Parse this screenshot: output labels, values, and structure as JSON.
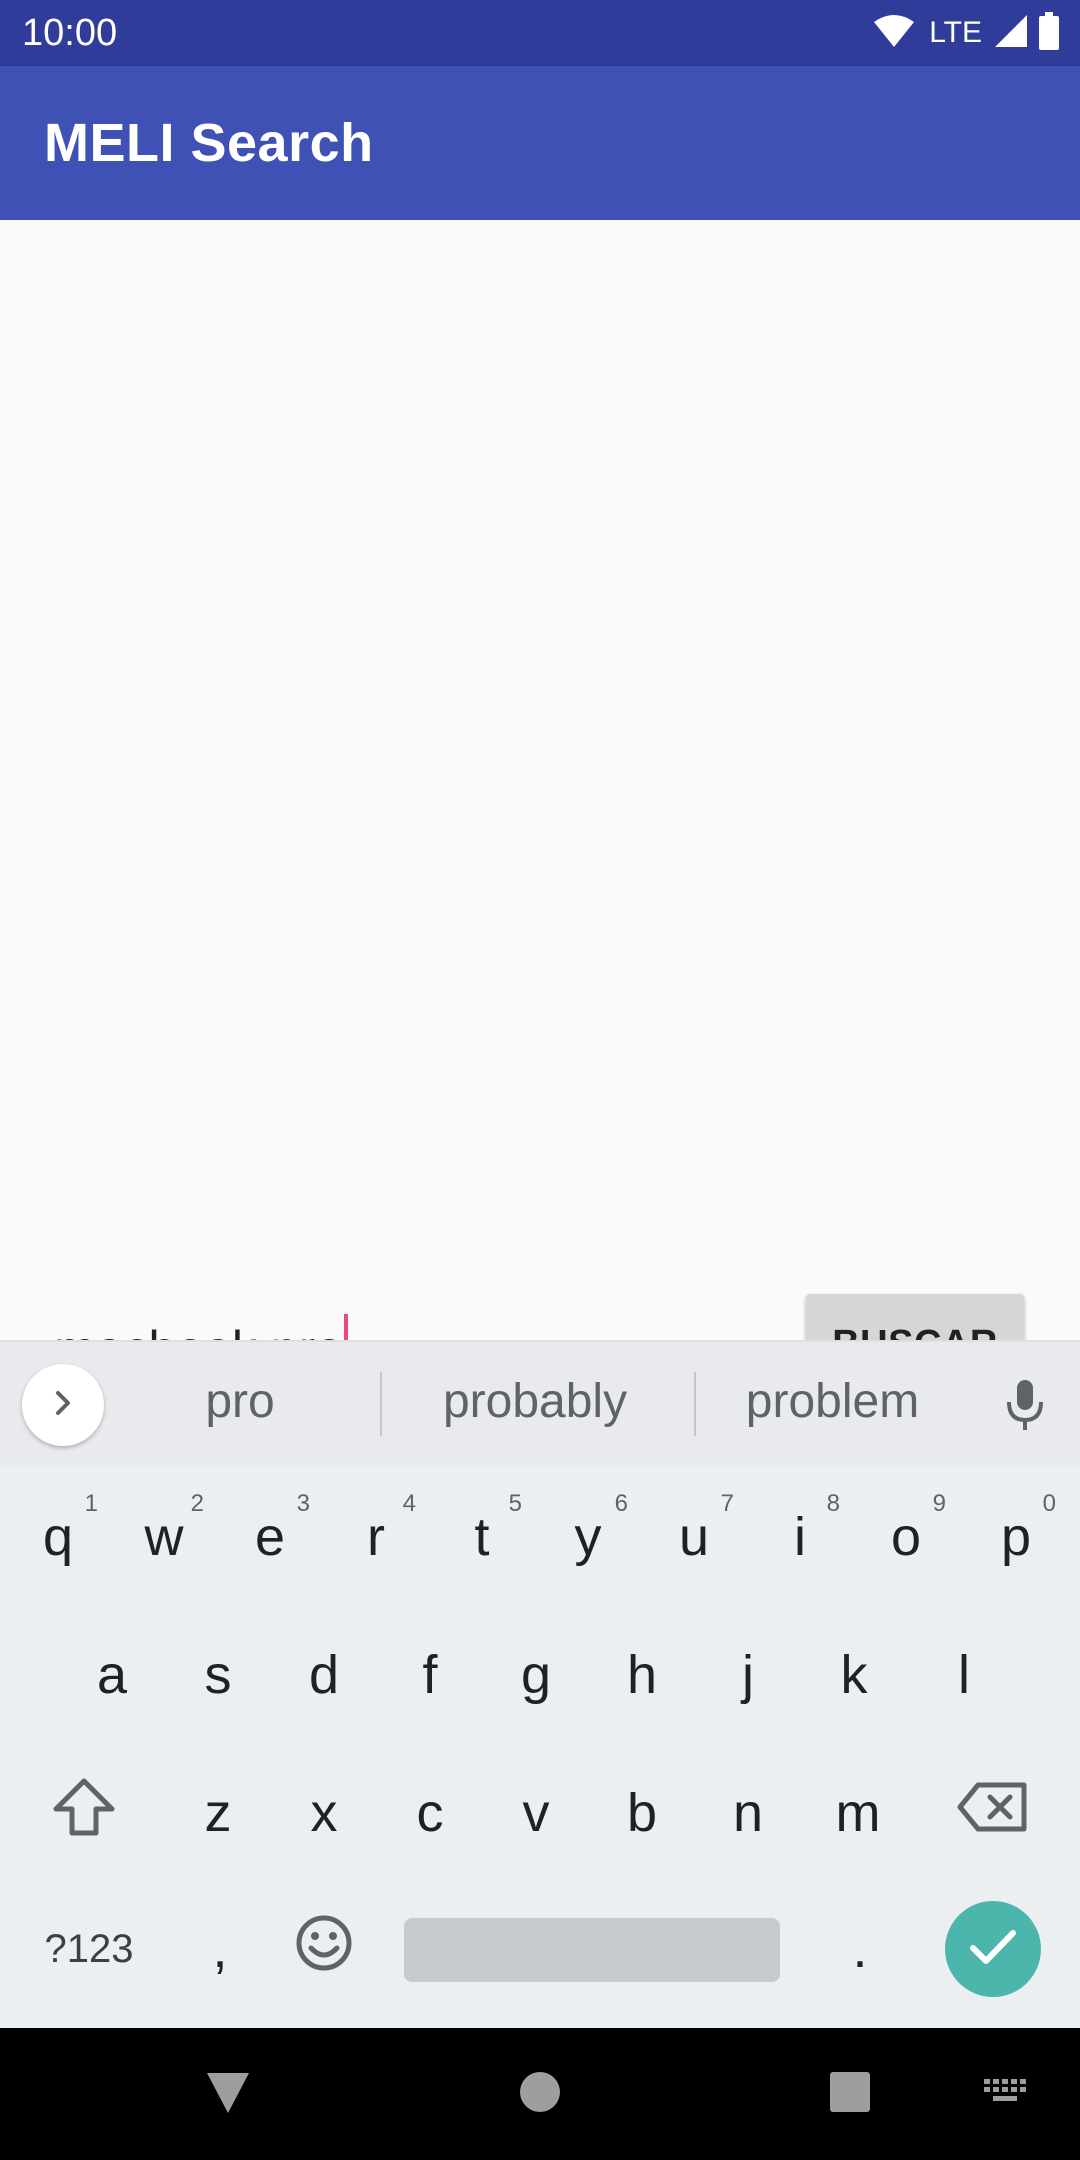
{
  "status_bar": {
    "time": "10:00",
    "network": "LTE"
  },
  "app_bar": {
    "title": "MELI Search"
  },
  "search": {
    "value_prefix": "macbook ",
    "value_current_word": "pro",
    "button_label": "BUSCAR"
  },
  "keyboard": {
    "suggestions": [
      "pro",
      "probably",
      "problem"
    ],
    "row1": [
      "q",
      "w",
      "e",
      "r",
      "t",
      "y",
      "u",
      "i",
      "o",
      "p"
    ],
    "row1_hints": [
      "1",
      "2",
      "3",
      "4",
      "5",
      "6",
      "7",
      "8",
      "9",
      "0"
    ],
    "row2": [
      "a",
      "s",
      "d",
      "f",
      "g",
      "h",
      "j",
      "k",
      "l"
    ],
    "row3": [
      "z",
      "x",
      "c",
      "v",
      "b",
      "n",
      "m"
    ],
    "symbols_label": "?123",
    "comma_label": ",",
    "period_label": "."
  },
  "colors": {
    "status_bar": "#2f3c99",
    "app_bar": "#3f51b5",
    "accent": "#e84a86",
    "enter": "#4db6ac"
  }
}
